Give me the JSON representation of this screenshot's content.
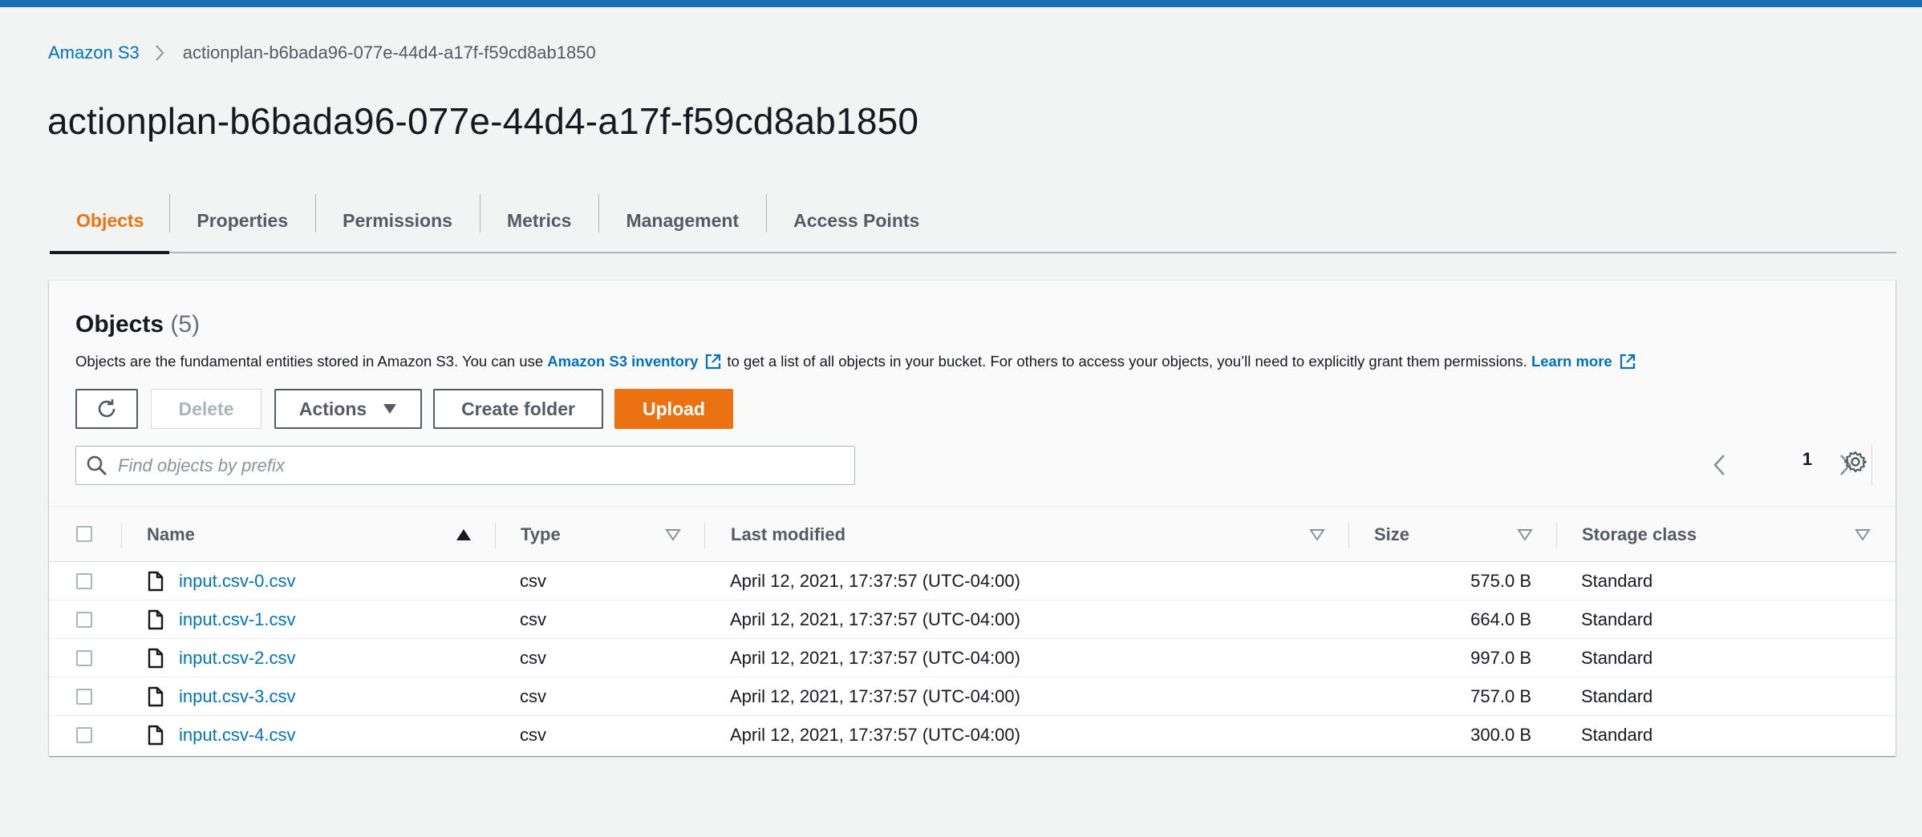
{
  "breadcrumb": {
    "root": "Amazon S3",
    "current": "actionplan-b6bada96-077e-44d4-a17f-f59cd8ab1850"
  },
  "page_title": "actionplan-b6bada96-077e-44d4-a17f-f59cd8ab1850",
  "tabs": [
    {
      "label": "Objects",
      "active": true
    },
    {
      "label": "Properties",
      "active": false
    },
    {
      "label": "Permissions",
      "active": false
    },
    {
      "label": "Metrics",
      "active": false
    },
    {
      "label": "Management",
      "active": false
    },
    {
      "label": "Access Points",
      "active": false
    }
  ],
  "objects_panel": {
    "title": "Objects",
    "count": "(5)",
    "description_prefix": "Objects are the fundamental entities stored in Amazon S3. You can use",
    "inventory_link": "Amazon S3 inventory",
    "description_suffix": "to get a list of all objects in your bucket. For others to access your objects, you’ll need to explicitly grant them permissions.",
    "learn_more": "Learn more"
  },
  "toolbar": {
    "delete_label": "Delete",
    "actions_label": "Actions",
    "create_folder_label": "Create folder",
    "upload_label": "Upload"
  },
  "search": {
    "placeholder": "Find objects by prefix"
  },
  "pagination": {
    "current_page": "1"
  },
  "table": {
    "columns": [
      "Name",
      "Type",
      "Last modified",
      "Size",
      "Storage class"
    ],
    "rows": [
      {
        "name": "input.csv-0.csv",
        "type": "csv",
        "last_modified": "April 12, 2021, 17:37:57 (UTC-04:00)",
        "size": "575.0 B",
        "storage_class": "Standard"
      },
      {
        "name": "input.csv-1.csv",
        "type": "csv",
        "last_modified": "April 12, 2021, 17:37:57 (UTC-04:00)",
        "size": "664.0 B",
        "storage_class": "Standard"
      },
      {
        "name": "input.csv-2.csv",
        "type": "csv",
        "last_modified": "April 12, 2021, 17:37:57 (UTC-04:00)",
        "size": "997.0 B",
        "storage_class": "Standard"
      },
      {
        "name": "input.csv-3.csv",
        "type": "csv",
        "last_modified": "April 12, 2021, 17:37:57 (UTC-04:00)",
        "size": "757.0 B",
        "storage_class": "Standard"
      },
      {
        "name": "input.csv-4.csv",
        "type": "csv",
        "last_modified": "April 12, 2021, 17:37:57 (UTC-04:00)",
        "size": "300.0 B",
        "storage_class": "Standard"
      }
    ]
  },
  "colors": {
    "accent_orange": "#ec7211",
    "link_blue": "#0073bb",
    "top_bar": "#1a6eb5",
    "background": "#f2f3f3"
  }
}
